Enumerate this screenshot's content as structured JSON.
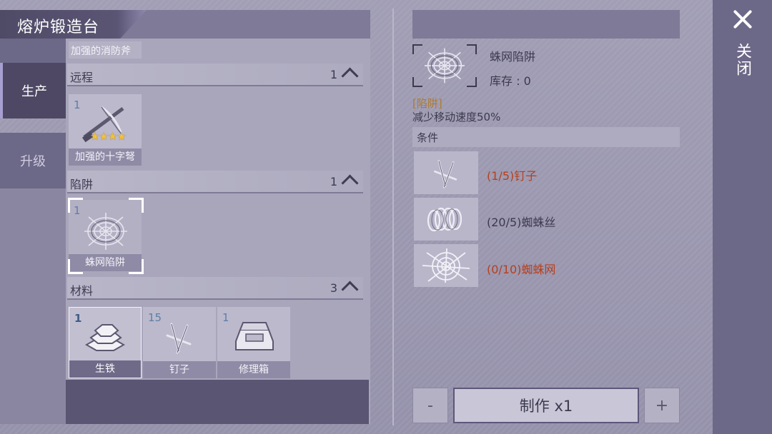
{
  "header": {
    "title": "熔炉锻造台"
  },
  "side_tabs": [
    {
      "label": "生产",
      "active": true
    },
    {
      "label": "升级",
      "active": false
    }
  ],
  "list": {
    "partial_item": {
      "name": "加强的消防斧"
    },
    "sections": [
      {
        "label": "远程",
        "count": "1",
        "items": [
          {
            "count": "1",
            "name": "加强的十字弩",
            "icon": "crossbow-icon",
            "stars": 4
          }
        ]
      },
      {
        "label": "陷阱",
        "count": "1",
        "items": [
          {
            "count": "1",
            "name": "蛛网陷阱",
            "icon": "spiderweb-trap-icon",
            "selected": true
          }
        ]
      },
      {
        "label": "材料",
        "count": "3",
        "items": [
          {
            "count": "1",
            "name": "生铁",
            "icon": "iron-ingot-icon",
            "selected": true
          },
          {
            "count": "15",
            "name": "钉子",
            "icon": "nails-icon"
          },
          {
            "count": "1",
            "name": "修理箱",
            "icon": "repair-kit-icon"
          }
        ]
      }
    ]
  },
  "detail": {
    "name": "蛛网陷阱",
    "stock": "库存 : 0",
    "category": "[陷阱]",
    "description": "减少移动速度50%",
    "conditions_label": "条件",
    "requirements": [
      {
        "text": "(1/5)钉子",
        "icon": "nails-icon",
        "met": false
      },
      {
        "text": "(20/5)蜘蛛丝",
        "icon": "spider-silk-icon",
        "met": true
      },
      {
        "text": "(0/10)蜘蛛网",
        "icon": "spider-web-icon",
        "met": false
      }
    ]
  },
  "actions": {
    "minus": "-",
    "craft": "制作 x1",
    "plus": "+"
  },
  "close": {
    "label": "关闭"
  },
  "colors": {
    "unmet": "#b5401e",
    "category": "#b07a2c",
    "accent": "#4e4864"
  }
}
